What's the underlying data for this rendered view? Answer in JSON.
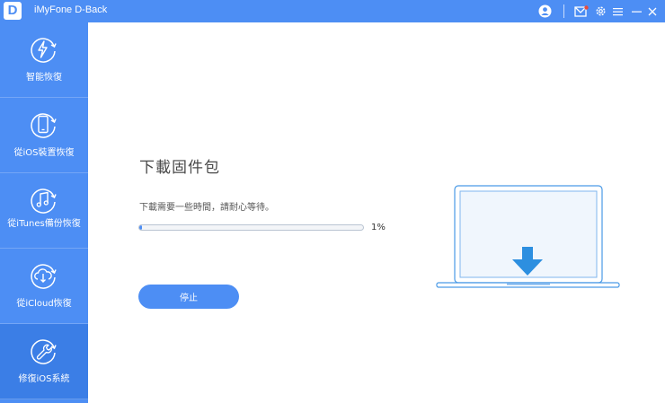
{
  "app": {
    "logo_letter": "D",
    "title": "iMyFone D-Back"
  },
  "titlebar": {
    "icons": [
      "account-icon",
      "mail-icon",
      "settings-icon",
      "menu-icon",
      "minimize-icon",
      "close-icon"
    ],
    "notification_color": "#e84b3c"
  },
  "sidebar": {
    "items": [
      {
        "label": "智能恢復",
        "icon": "lightning-icon",
        "active": false
      },
      {
        "label": "從iOS裝置恢復",
        "icon": "phone-icon",
        "active": false
      },
      {
        "label": "從iTunes備份恢復",
        "icon": "music-icon",
        "active": false
      },
      {
        "label": "從iCloud恢復",
        "icon": "cloud-download-icon",
        "active": false
      },
      {
        "label": "修復iOS系統",
        "icon": "wrench-icon",
        "active": true
      }
    ]
  },
  "main": {
    "heading": "下載固件包",
    "subtext": "下載需要一些時間，請耐心等待。",
    "progress": {
      "value": 0.01,
      "label": "1%"
    },
    "stop_button": "停止",
    "illustration": "laptop-download-icon"
  },
  "colors": {
    "accent": "#4d8ef4",
    "sidebar_active": "#3b7ee6",
    "illustration_arrow": "#2d8fe0",
    "illustration_screen": "#f0f6fd"
  }
}
